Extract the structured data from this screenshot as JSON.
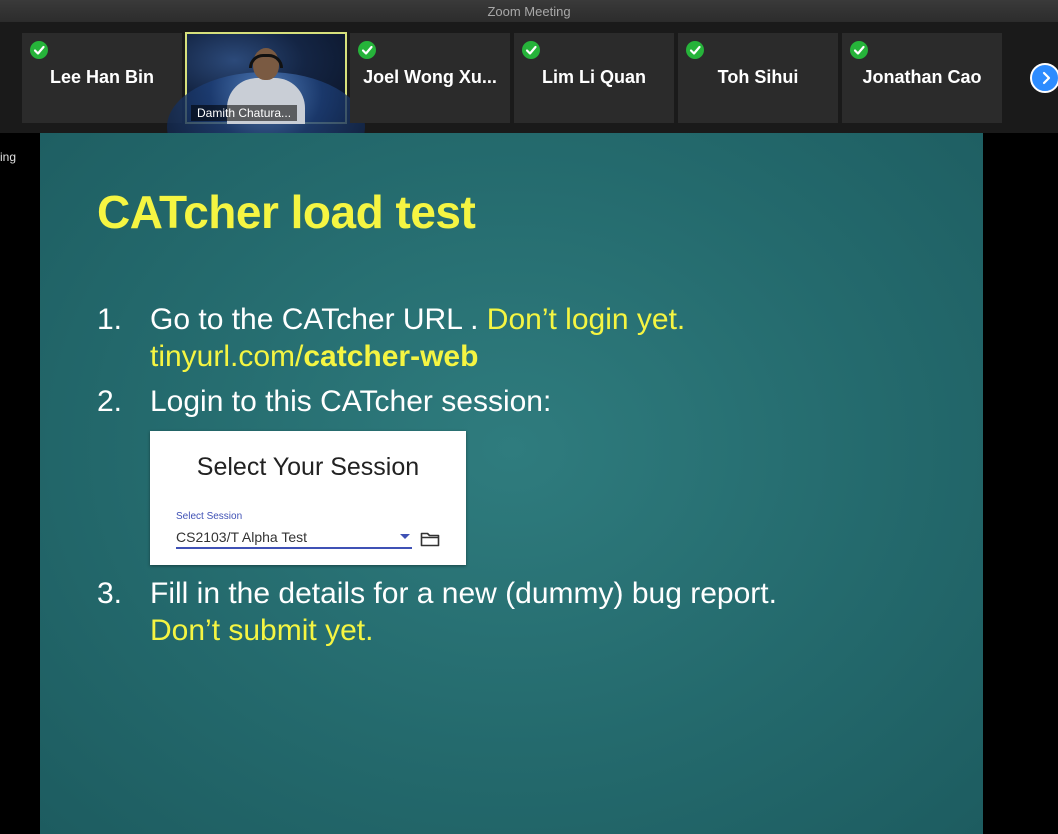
{
  "window": {
    "title": "Zoom Meeting"
  },
  "participants": [
    {
      "name": "Lee Han Bin",
      "verified": true
    },
    {
      "name": "Damith Chatura...",
      "video": true
    },
    {
      "name": "Joel Wong Xu...",
      "verified": true
    },
    {
      "name": "Lim Li Quan",
      "verified": true
    },
    {
      "name": "Toh Sihui",
      "verified": true
    },
    {
      "name": "Jonathan Cao",
      "verified": true
    }
  ],
  "strip": {
    "next_icon": "chevron-right-icon"
  },
  "side_text": "ing",
  "slide": {
    "title": "CATcher load test",
    "items": [
      {
        "number": "1.",
        "text": "Go to the CATcher URL . ",
        "highlight": "Don’t login yet.",
        "link_prefix": "tinyurl.com/",
        "link_bold": "catcher-web"
      },
      {
        "number": "2.",
        "text": "Login to this CATcher session:"
      },
      {
        "number": "3.",
        "text": "Fill in the details for a new (dummy) bug report.",
        "highlight": "Don’t submit yet."
      }
    ],
    "session_card": {
      "title": "Select Your Session",
      "field_label": "Select Session",
      "field_value": "CS2103/T Alpha Test",
      "dropdown_icon": "caret-down-icon",
      "folder_icon": "folder-icon"
    }
  },
  "colors": {
    "slide_bg": "#246a6d",
    "accent_yellow": "#f5f542",
    "verified_green": "#26b33a",
    "zoom_blue": "#2d8cff",
    "material_indigo": "#3f51b5"
  }
}
